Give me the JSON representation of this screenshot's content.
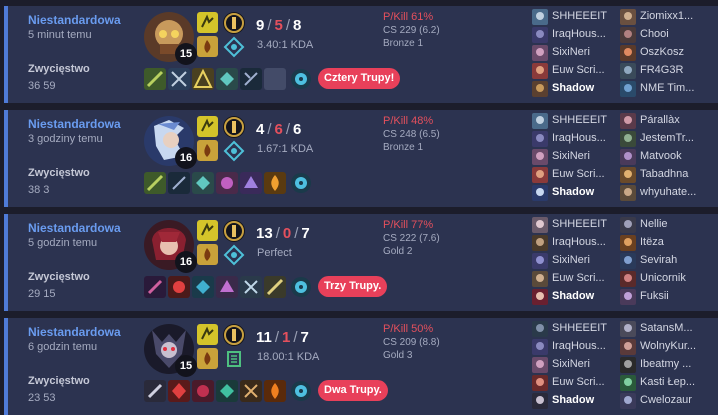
{
  "matches": [
    {
      "queue": "Niestandardowa",
      "time_ago": "5 minut temu",
      "result": "Zwycięstwo",
      "duration": "36 59",
      "champion_icon": "champion-portrait-helmet",
      "level": "15",
      "spells": [
        "flash-spell-icon",
        "ignite-spell-icon"
      ],
      "runes": [
        "keystone-rune-icon",
        "secondary-rune-tree-icon"
      ],
      "kills": "9",
      "deaths": "5",
      "assists": "8",
      "kda_ratio": "3.40:1 KDA",
      "items": [
        "item-icon",
        "item-icon",
        "item-icon",
        "item-icon",
        "item-icon",
        "empty-slot",
        "ward-icon"
      ],
      "multikill": "Cztery Trupy!",
      "pkill": "P/Kill 61%",
      "cs": "CS 229 (6.2)",
      "rank": "Bronze 1",
      "team1": [
        "SHHEEEIT",
        "IraqHous...",
        "SixiNeri",
        "Euw Scri...",
        "Shadow"
      ],
      "team2": [
        "Ziomixx1...",
        "Chooi",
        "OszKosz",
        "FR4G3R",
        "NME Tim..."
      ],
      "accent": "#e8405a"
    },
    {
      "queue": "Niestandardowa",
      "time_ago": "3 godziny temu",
      "result": "Zwycięstwo",
      "duration": "38 3",
      "champion_icon": "champion-portrait-assassin",
      "level": "16",
      "spells": [
        "flash-spell-icon",
        "ignite-spell-icon"
      ],
      "runes": [
        "keystone-rune-icon",
        "secondary-rune-tree-icon"
      ],
      "kills": "4",
      "deaths": "6",
      "assists": "6",
      "kda_ratio": "1.67:1 KDA",
      "items": [
        "item-icon",
        "item-icon",
        "item-icon",
        "item-icon",
        "item-icon",
        "item-icon",
        "ward-icon"
      ],
      "multikill": "",
      "pkill": "P/Kill 48%",
      "cs": "CS 248 (6.5)",
      "rank": "Bronze 1",
      "team1": [
        "SHHEEEIT",
        "IraqHous...",
        "SixiNeri",
        "Euw Scri...",
        "Shadow"
      ],
      "team2": [
        "Párallàx",
        "JestemTr...",
        "Matvook",
        "Tabadhna",
        "whyuhate..."
      ],
      "accent": "#e8405a"
    },
    {
      "queue": "Niestandardowa",
      "time_ago": "5 godzin temu",
      "result": "Zwycięstwo",
      "duration": "29 15",
      "champion_icon": "champion-portrait-swordswoman",
      "level": "16",
      "spells": [
        "flash-spell-icon",
        "ignite-spell-icon"
      ],
      "runes": [
        "keystone-rune-icon",
        "secondary-rune-tree-icon"
      ],
      "kills": "13",
      "deaths": "0",
      "assists": "7",
      "kda_ratio": "Perfect",
      "items": [
        "item-icon",
        "item-icon",
        "item-icon",
        "item-icon",
        "item-icon",
        "item-icon",
        "ward-icon"
      ],
      "multikill": "Trzy Trupy.",
      "pkill": "P/Kill 77%",
      "cs": "CS 222 (7.6)",
      "rank": "Gold 2",
      "team1": [
        "SHHEEEIT",
        "IraqHous...",
        "SixiNeri",
        "Euw Scri...",
        "Shadow"
      ],
      "team2": [
        "Nellie",
        "Itёza",
        "Sevirah",
        "Unicornik",
        "Fuksii"
      ],
      "accent": "#e8405a"
    },
    {
      "queue": "Niestandardowa",
      "time_ago": "6 godzin temu",
      "result": "Zwycięstwo",
      "duration": "23 53",
      "champion_icon": "champion-portrait-demon",
      "level": "15",
      "spells": [
        "flash-spell-icon",
        "ignite-spell-icon"
      ],
      "runes": [
        "keystone-rune-icon",
        "secondary-rune-tree-icon"
      ],
      "kills": "11",
      "deaths": "1",
      "assists": "7",
      "kda_ratio": "18.00:1 KDA",
      "items": [
        "item-icon",
        "item-icon",
        "item-icon",
        "item-icon",
        "item-icon",
        "item-icon",
        "ward-icon"
      ],
      "multikill": "Dwa Trupy.",
      "pkill": "P/Kill 50%",
      "cs": "CS 209 (8.8)",
      "rank": "Gold 3",
      "team1": [
        "SHHEEEIT",
        "IraqHous...",
        "SixiNeri",
        "Euw Scri...",
        "Shadow"
      ],
      "team2": [
        "SatansM...",
        "WolnyKur...",
        "Ibeatmy ...",
        "Kasti Łep...",
        "Cwelozaur"
      ],
      "accent": "#e8405a"
    }
  ],
  "colors": {
    "card_bg": "#2c3350",
    "card_border": "#4f7bd8",
    "queue": "#6a9cf0",
    "death": "#e4505d",
    "badge": "#e8405a"
  }
}
